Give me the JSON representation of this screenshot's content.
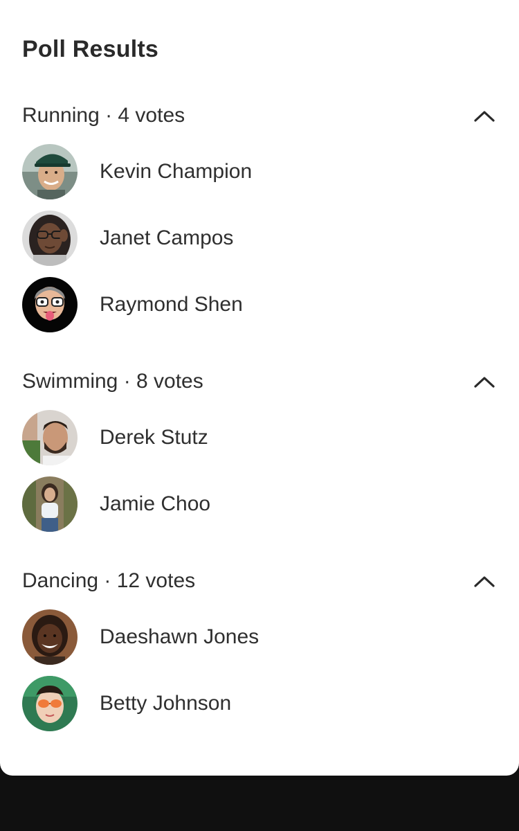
{
  "title": "Poll Results",
  "sections": [
    {
      "header": "Running · 4 votes",
      "voters": [
        {
          "name": "Kevin Champion",
          "avatar": "photo-man-green-cap"
        },
        {
          "name": "Janet Campos",
          "avatar": "photo-woman-glasses"
        },
        {
          "name": "Raymond Shen",
          "avatar": "memoji-glasses-tongue"
        }
      ]
    },
    {
      "header": "Swimming · 8 votes",
      "voters": [
        {
          "name": "Derek Stutz",
          "avatar": "photo-man-beard"
        },
        {
          "name": "Jamie Choo",
          "avatar": "photo-woman-outdoor"
        }
      ]
    },
    {
      "header": "Dancing · 12 votes",
      "voters": [
        {
          "name": "Daeshawn Jones",
          "avatar": "photo-man-smiling-locs"
        },
        {
          "name": "Betty Johnson",
          "avatar": "photo-woman-sunglasses"
        }
      ]
    }
  ],
  "icons": {
    "collapse": "chevron-up-icon"
  },
  "colors": {
    "text": "#2f2f2f",
    "backdrop": "#101010",
    "sheet": "#ffffff"
  }
}
